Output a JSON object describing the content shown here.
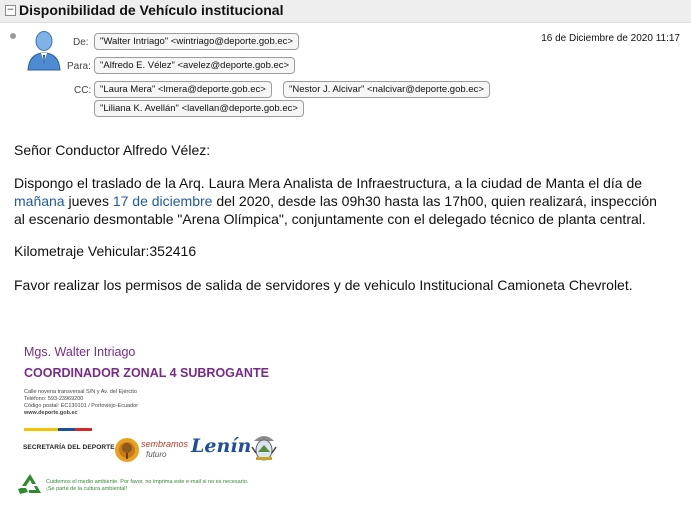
{
  "header": {
    "title": "Disponibilidad de Vehículo institucional",
    "collapse_symbol": "−"
  },
  "meta": {
    "from_label": "De:",
    "to_label": "Para:",
    "cc_label": "CC:",
    "from": "\"Walter Intriago\" <wintriago@deporte.gob.ec>",
    "to": "\"Alfredo E. Vélez\" <avelez@deporte.gob.ec>",
    "cc": [
      "\"Laura Mera\" <lmera@deporte.gob.ec>",
      "\"Nestor J. Alcivar\" <nalcivar@deporte.gob.ec>",
      "\"Liliana K. Avellán\" <lavellan@deporte.gob.ec>"
    ],
    "date": "16 de Diciembre de 2020 11:17"
  },
  "body": {
    "greeting": "Señor Conductor Alfredo Vélez:",
    "p1_a": "Dispongo el traslado de la Arq. Laura Mera Analista de Infraestructura, a la ciudad de Manta el día de",
    "p1_link1": "mañana",
    "p1_b": " jueves ",
    "p1_link2": "17 de diciembre",
    "p1_c": " del 2020, desde las 09h30 hasta las 17h00, quien realizará, inspección",
    "p1_d": "al escenario desmontable \"Arena Olímpica\", conjuntamente con el delegado técnico de planta central.",
    "km": "Kilometraje Vehicular:352416",
    "p3": "Favor realizar los permisos de salida de servidores y de vehiculo Institucional Camioneta Chevrolet."
  },
  "signature": {
    "name": "Mgs. Walter Intriago",
    "role": "COORDINADOR ZONAL 4 SUBROGANTE",
    "address": "Calle novena transversal S/N y Av. del Ejército",
    "phone": "Teléfono: 593-23969200",
    "postal": "Código postal: EC130101 / Portoviejo-Ecuador",
    "web": "www.deporte.gob.ec",
    "secretaria": "SECRETARÍA DEL DEPORTE",
    "logo2_a": "sembramos",
    "logo2_b": "futuro",
    "logo3": "Lenín",
    "eco1": "Cuidemos el medio ambiente. Por favor, no imprima este e-mail si no es necesario.",
    "eco2": "¡Se parte de la cultura ambiental!"
  },
  "colors": {
    "link": "#1f5aa6",
    "signature": "#7a2a8a",
    "eco": "#2e8b2e"
  }
}
